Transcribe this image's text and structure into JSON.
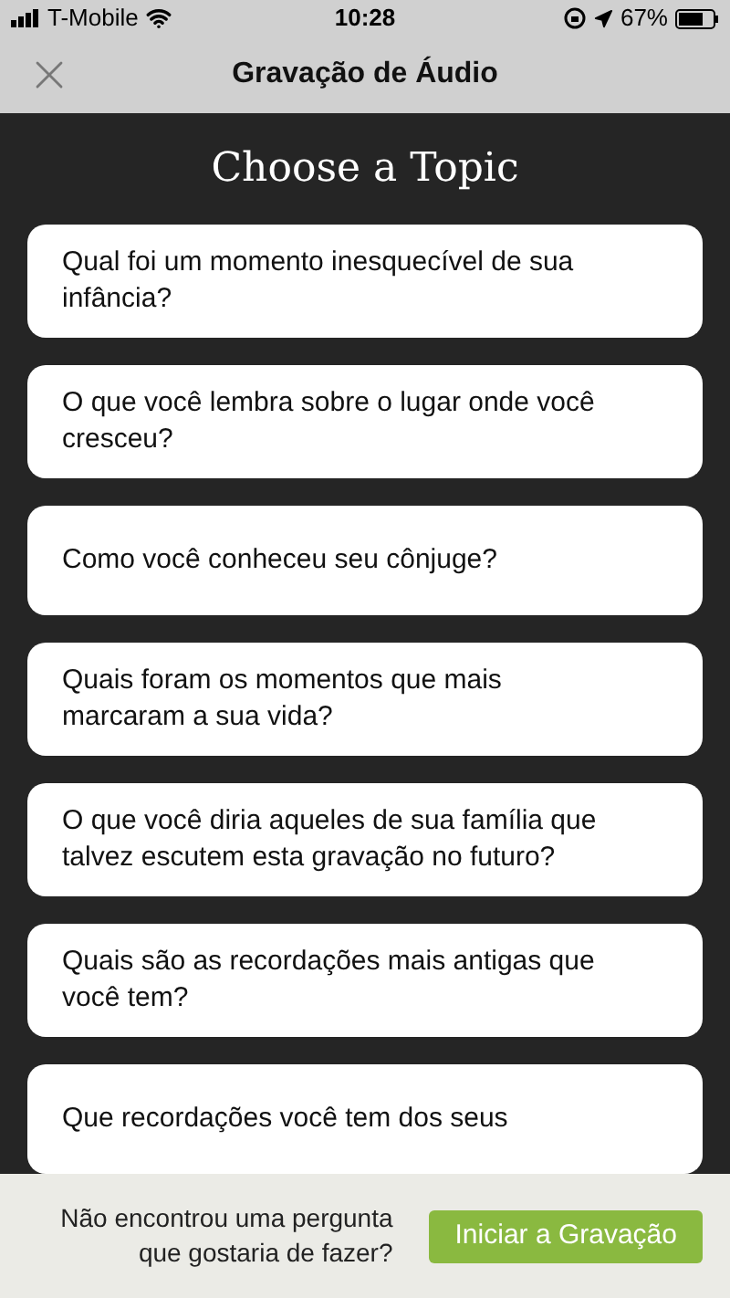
{
  "status_bar": {
    "carrier": "T-Mobile",
    "time": "10:28",
    "battery": "67%"
  },
  "header": {
    "title": "Gravação de Áudio"
  },
  "heading": "Choose a Topic",
  "topics": [
    {
      "text": "Qual foi um momento inesquecível de sua infância?"
    },
    {
      "text": "O que você lembra sobre o lugar onde você cresceu?"
    },
    {
      "text": "Como você conheceu seu cônjuge?"
    },
    {
      "text": "Quais foram os momentos que mais marcaram a sua vida?"
    },
    {
      "text": "O que você diria aqueles de sua família que talvez escutem esta gravação no futuro?"
    },
    {
      "text": "Quais são as recordações mais antigas que você tem?"
    },
    {
      "text": "Que recordações você tem dos seus"
    }
  ],
  "footer": {
    "prompt": "Não encontrou uma pergunta que gostaria de fazer?",
    "button": "Iniciar a Gravação"
  }
}
